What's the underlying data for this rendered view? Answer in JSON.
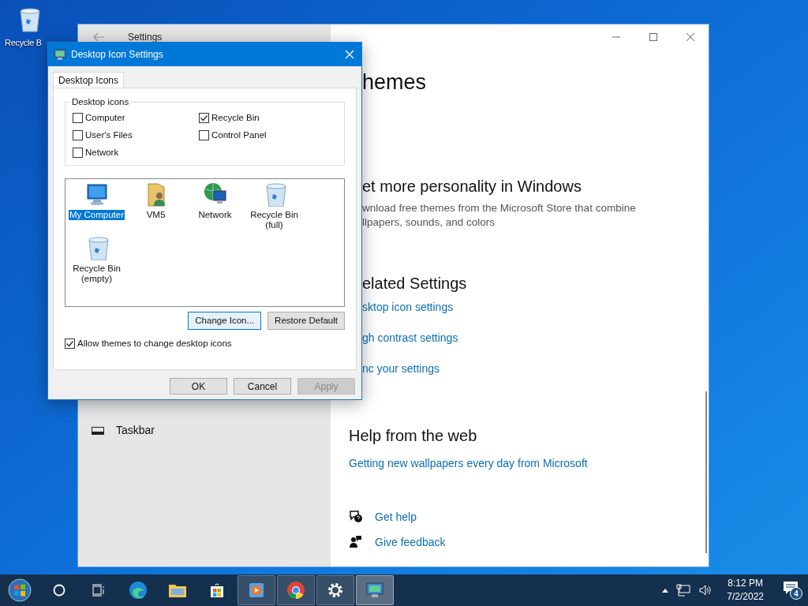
{
  "desktop_icons": [
    {
      "label": "Recycle B"
    }
  ],
  "settings_window": {
    "title": "Settings",
    "sidebar": [
      {
        "label": "Taskbar"
      }
    ],
    "heading": "hemes",
    "promo": {
      "heading": "et more personality in Windows",
      "lines": [
        "wnload free themes from the Microsoft Store that combine",
        "llpapers, sounds, and colors"
      ]
    },
    "related": {
      "heading": "elated Settings",
      "links": [
        "sktop icon settings",
        "gh contrast settings",
        "nc your settings"
      ]
    },
    "help": {
      "heading": "Help from the web",
      "links": [
        "Getting new wallpapers every day from Microsoft"
      ]
    },
    "actions": [
      {
        "kind": "help",
        "label": "Get help"
      },
      {
        "kind": "feedback",
        "label": "Give feedback"
      }
    ]
  },
  "dialog": {
    "title": "Desktop Icon Settings",
    "tabs": [
      {
        "label": "Desktop Icons",
        "selected": true
      }
    ],
    "group": {
      "label": "Desktop icons",
      "checkboxes": [
        {
          "label": "Computer",
          "checked": false
        },
        {
          "label": "Recycle Bin",
          "checked": true
        },
        {
          "label": "User's Files",
          "checked": false
        },
        {
          "label": "Control Panel",
          "checked": false
        },
        {
          "label": "Network",
          "checked": false
        }
      ]
    },
    "icons": [
      {
        "kind": "computer",
        "label": "My Computer",
        "selected": true
      },
      {
        "kind": "user-folder",
        "label": "VM5",
        "selected": false
      },
      {
        "kind": "network",
        "label": "Network",
        "selected": false
      },
      {
        "kind": "bin-full",
        "label": "Recycle Bin (full)",
        "selected": false
      },
      {
        "kind": "bin-empty",
        "label": "Recycle Bin (empty)",
        "selected": false
      }
    ],
    "icon_buttons": [
      {
        "label": "Change Icon...",
        "focused": true
      },
      {
        "label": "Restore Default",
        "focused": false
      }
    ],
    "allow_themes": {
      "label": "Allow themes to change desktop icons",
      "checked": true
    },
    "footer_buttons": [
      {
        "label": "OK",
        "disabled": false
      },
      {
        "label": "Cancel",
        "disabled": false
      },
      {
        "label": "Apply",
        "disabled": true
      }
    ]
  },
  "taskbar": {
    "buttons": [
      {
        "kind": "start",
        "running": false,
        "selected": false
      },
      {
        "kind": "search",
        "running": false,
        "selected": false
      },
      {
        "kind": "task-view",
        "running": false,
        "selected": false
      },
      {
        "kind": "browser",
        "running": false,
        "selected": false
      },
      {
        "kind": "folder",
        "running": false,
        "selected": false
      },
      {
        "kind": "store",
        "running": false,
        "selected": false
      },
      {
        "kind": "media",
        "running": true,
        "selected": false
      },
      {
        "kind": "chrome",
        "running": true,
        "selected": false
      },
      {
        "kind": "settings",
        "running": true,
        "selected": false
      },
      {
        "kind": "display",
        "running": true,
        "selected": true
      }
    ],
    "time": "8:12 PM",
    "date": "7/2/2022",
    "notifications": "4"
  }
}
